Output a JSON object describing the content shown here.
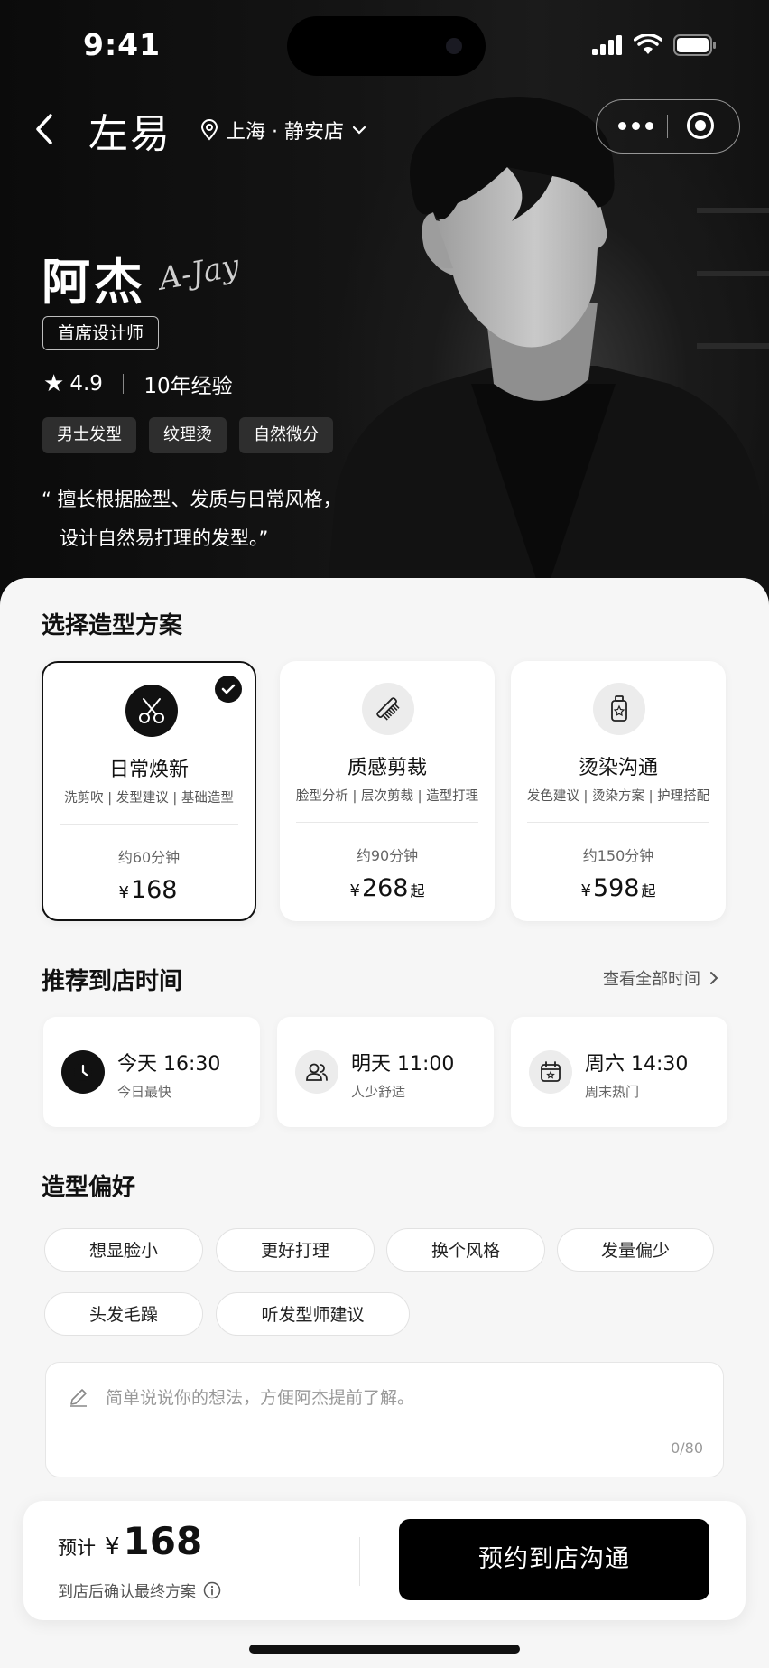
{
  "status_bar": {
    "time": "9:41"
  },
  "nav": {
    "brand": "左易",
    "location": "上海 · 静安店"
  },
  "stylist": {
    "name": "阿杰",
    "signature": "A-Jay",
    "title": "首席设计师",
    "rating": "4.9",
    "experience": "10年经验",
    "tags": [
      "男士发型",
      "纹理烫",
      "自然微分"
    ],
    "quote_line1": "“ 擅长根据脸型、发质与日常风格，",
    "quote_line2": "设计自然易打理的发型。”"
  },
  "plans": {
    "section_title": "选择造型方案",
    "items": [
      {
        "name": "日常焕新",
        "desc": "洗剪吹 | 发型建议 | 基础造型",
        "duration": "约60分钟",
        "currency": "¥",
        "price": "168",
        "suffix": "",
        "icon": "scissors-icon",
        "selected": true
      },
      {
        "name": "质感剪裁",
        "desc": "脸型分析 | 层次剪裁 | 造型打理",
        "duration": "约90分钟",
        "currency": "¥",
        "price": "268",
        "suffix": "起",
        "icon": "comb-icon",
        "selected": false
      },
      {
        "name": "烫染沟通",
        "desc": "发色建议 | 烫染方案 | 护理搭配",
        "duration": "约150分钟",
        "currency": "¥",
        "price": "598",
        "suffix": "起",
        "icon": "bottle-icon",
        "selected": false
      }
    ]
  },
  "times": {
    "section_title": "推荐到店时间",
    "view_all": "查看全部时间",
    "slots": [
      {
        "time": "今天  16:30",
        "sub": "今日最快",
        "icon": "clock-icon"
      },
      {
        "time": "明天  11:00",
        "sub": "人少舒适",
        "icon": "people-icon"
      },
      {
        "time": "周六  14:30",
        "sub": "周末热门",
        "icon": "calendar-icon"
      }
    ]
  },
  "preferences": {
    "section_title": "造型偏好",
    "options": [
      "想显脸小",
      "更好打理",
      "换个风格",
      "发量偏少",
      "头发毛躁",
      "听发型师建议"
    ],
    "note_placeholder": "简单说说你的想法，方便阿杰提前了解。",
    "note_count": "0/80"
  },
  "footer": {
    "estimate_label": "预计",
    "currency": "¥",
    "amount": "168",
    "hint": "到店后确认最终方案",
    "cta": "预约到店沟通"
  },
  "colors": {
    "accent": "#111111",
    "hero_bg": "#0f0f0f",
    "sheet_bg": "#f6f6f6"
  }
}
